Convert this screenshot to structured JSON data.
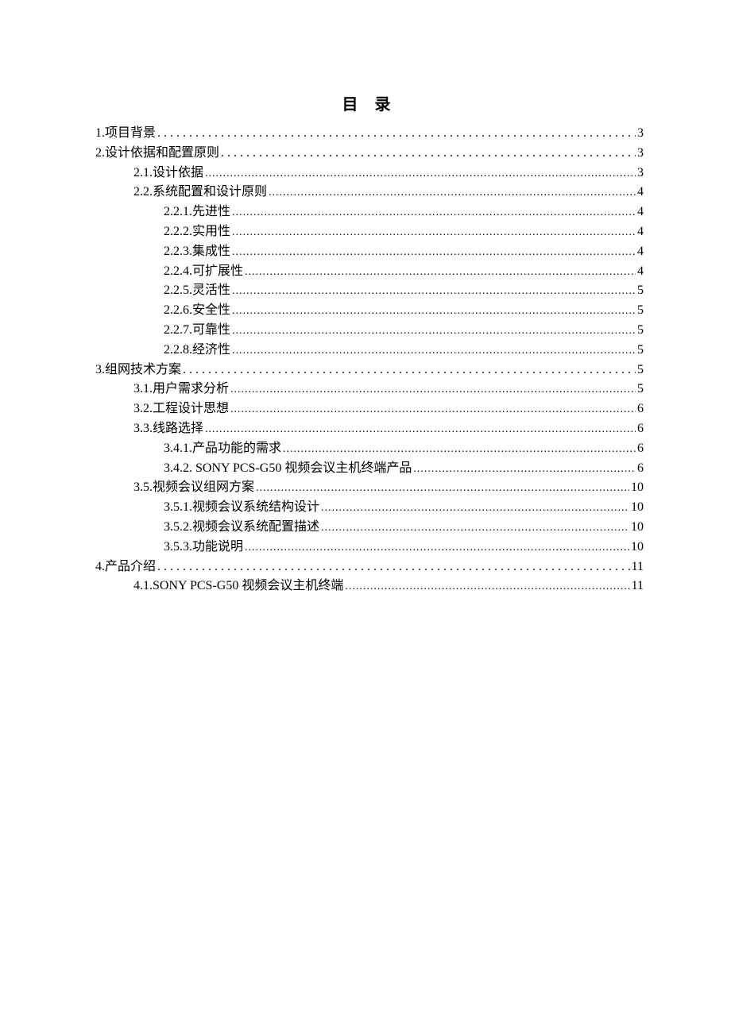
{
  "title": "目 录",
  "entries": [
    {
      "label": "1.项目背景",
      "page": "3",
      "indent": 0,
      "leader": "wide-dots"
    },
    {
      "label": "2.设计依据和配置原则",
      "page": "3",
      "indent": 0,
      "leader": "wide-dots"
    },
    {
      "label": "2.1.设计依据",
      "page": "3",
      "indent": 1,
      "leader": "dots"
    },
    {
      "label": "2.2.系统配置和设计原则",
      "page": "4",
      "indent": 1,
      "leader": "dots"
    },
    {
      "label": "2.2.1.先进性",
      "page": "4",
      "indent": 2,
      "leader": "dots"
    },
    {
      "label": "2.2.2.实用性",
      "page": "4",
      "indent": 2,
      "leader": "dots"
    },
    {
      "label": "2.2.3.集成性",
      "page": "4",
      "indent": 2,
      "leader": "dots"
    },
    {
      "label": "2.2.4.可扩展性",
      "page": "4",
      "indent": 2,
      "leader": "dots"
    },
    {
      "label": "2.2.5.灵活性",
      "page": "5",
      "indent": 2,
      "leader": "dots"
    },
    {
      "label": "2.2.6.安全性",
      "page": "5",
      "indent": 2,
      "leader": "dots"
    },
    {
      "label": "2.2.7.可靠性",
      "page": "5",
      "indent": 2,
      "leader": "dots"
    },
    {
      "label": "2.2.8.经济性",
      "page": "5",
      "indent": 2,
      "leader": "dots"
    },
    {
      "label": "3.组网技术方案",
      "page": "5",
      "indent": 0,
      "leader": "wide-dots"
    },
    {
      "label": "3.1.用户需求分析",
      "page": "5",
      "indent": 1,
      "leader": "dots"
    },
    {
      "label": "3.2.工程设计思想",
      "page": "6",
      "indent": 1,
      "leader": "dots"
    },
    {
      "label": "3.3.线路选择",
      "page": "6",
      "indent": 1,
      "leader": "dots"
    },
    {
      "label": "3.4.1.产品功能的需求",
      "page": "6",
      "indent": 2,
      "leader": "dots"
    },
    {
      "label": "3.4.2. SONY PCS-G50 视频会议主机终端产品",
      "page": "6",
      "indent": 2,
      "leader": "dots"
    },
    {
      "label": "3.5.视频会议组网方案",
      "page": "10",
      "indent": 1,
      "leader": "dots"
    },
    {
      "label": "3.5.1.视频会议系统结构设计",
      "page": "10",
      "indent": 2,
      "leader": "dots"
    },
    {
      "label": "3.5.2.视频会议系统配置描述",
      "page": "10",
      "indent": 2,
      "leader": "dots"
    },
    {
      "label": "3.5.3.功能说明",
      "page": "10",
      "indent": 2,
      "leader": "dots"
    },
    {
      "label": "4.产品介绍",
      "page": "11",
      "indent": 0,
      "leader": "wide-dots"
    },
    {
      "label": "4.1.SONY PCS-G50 视频会议主机终端",
      "page": "11",
      "indent": 1,
      "leader": "dots"
    }
  ]
}
